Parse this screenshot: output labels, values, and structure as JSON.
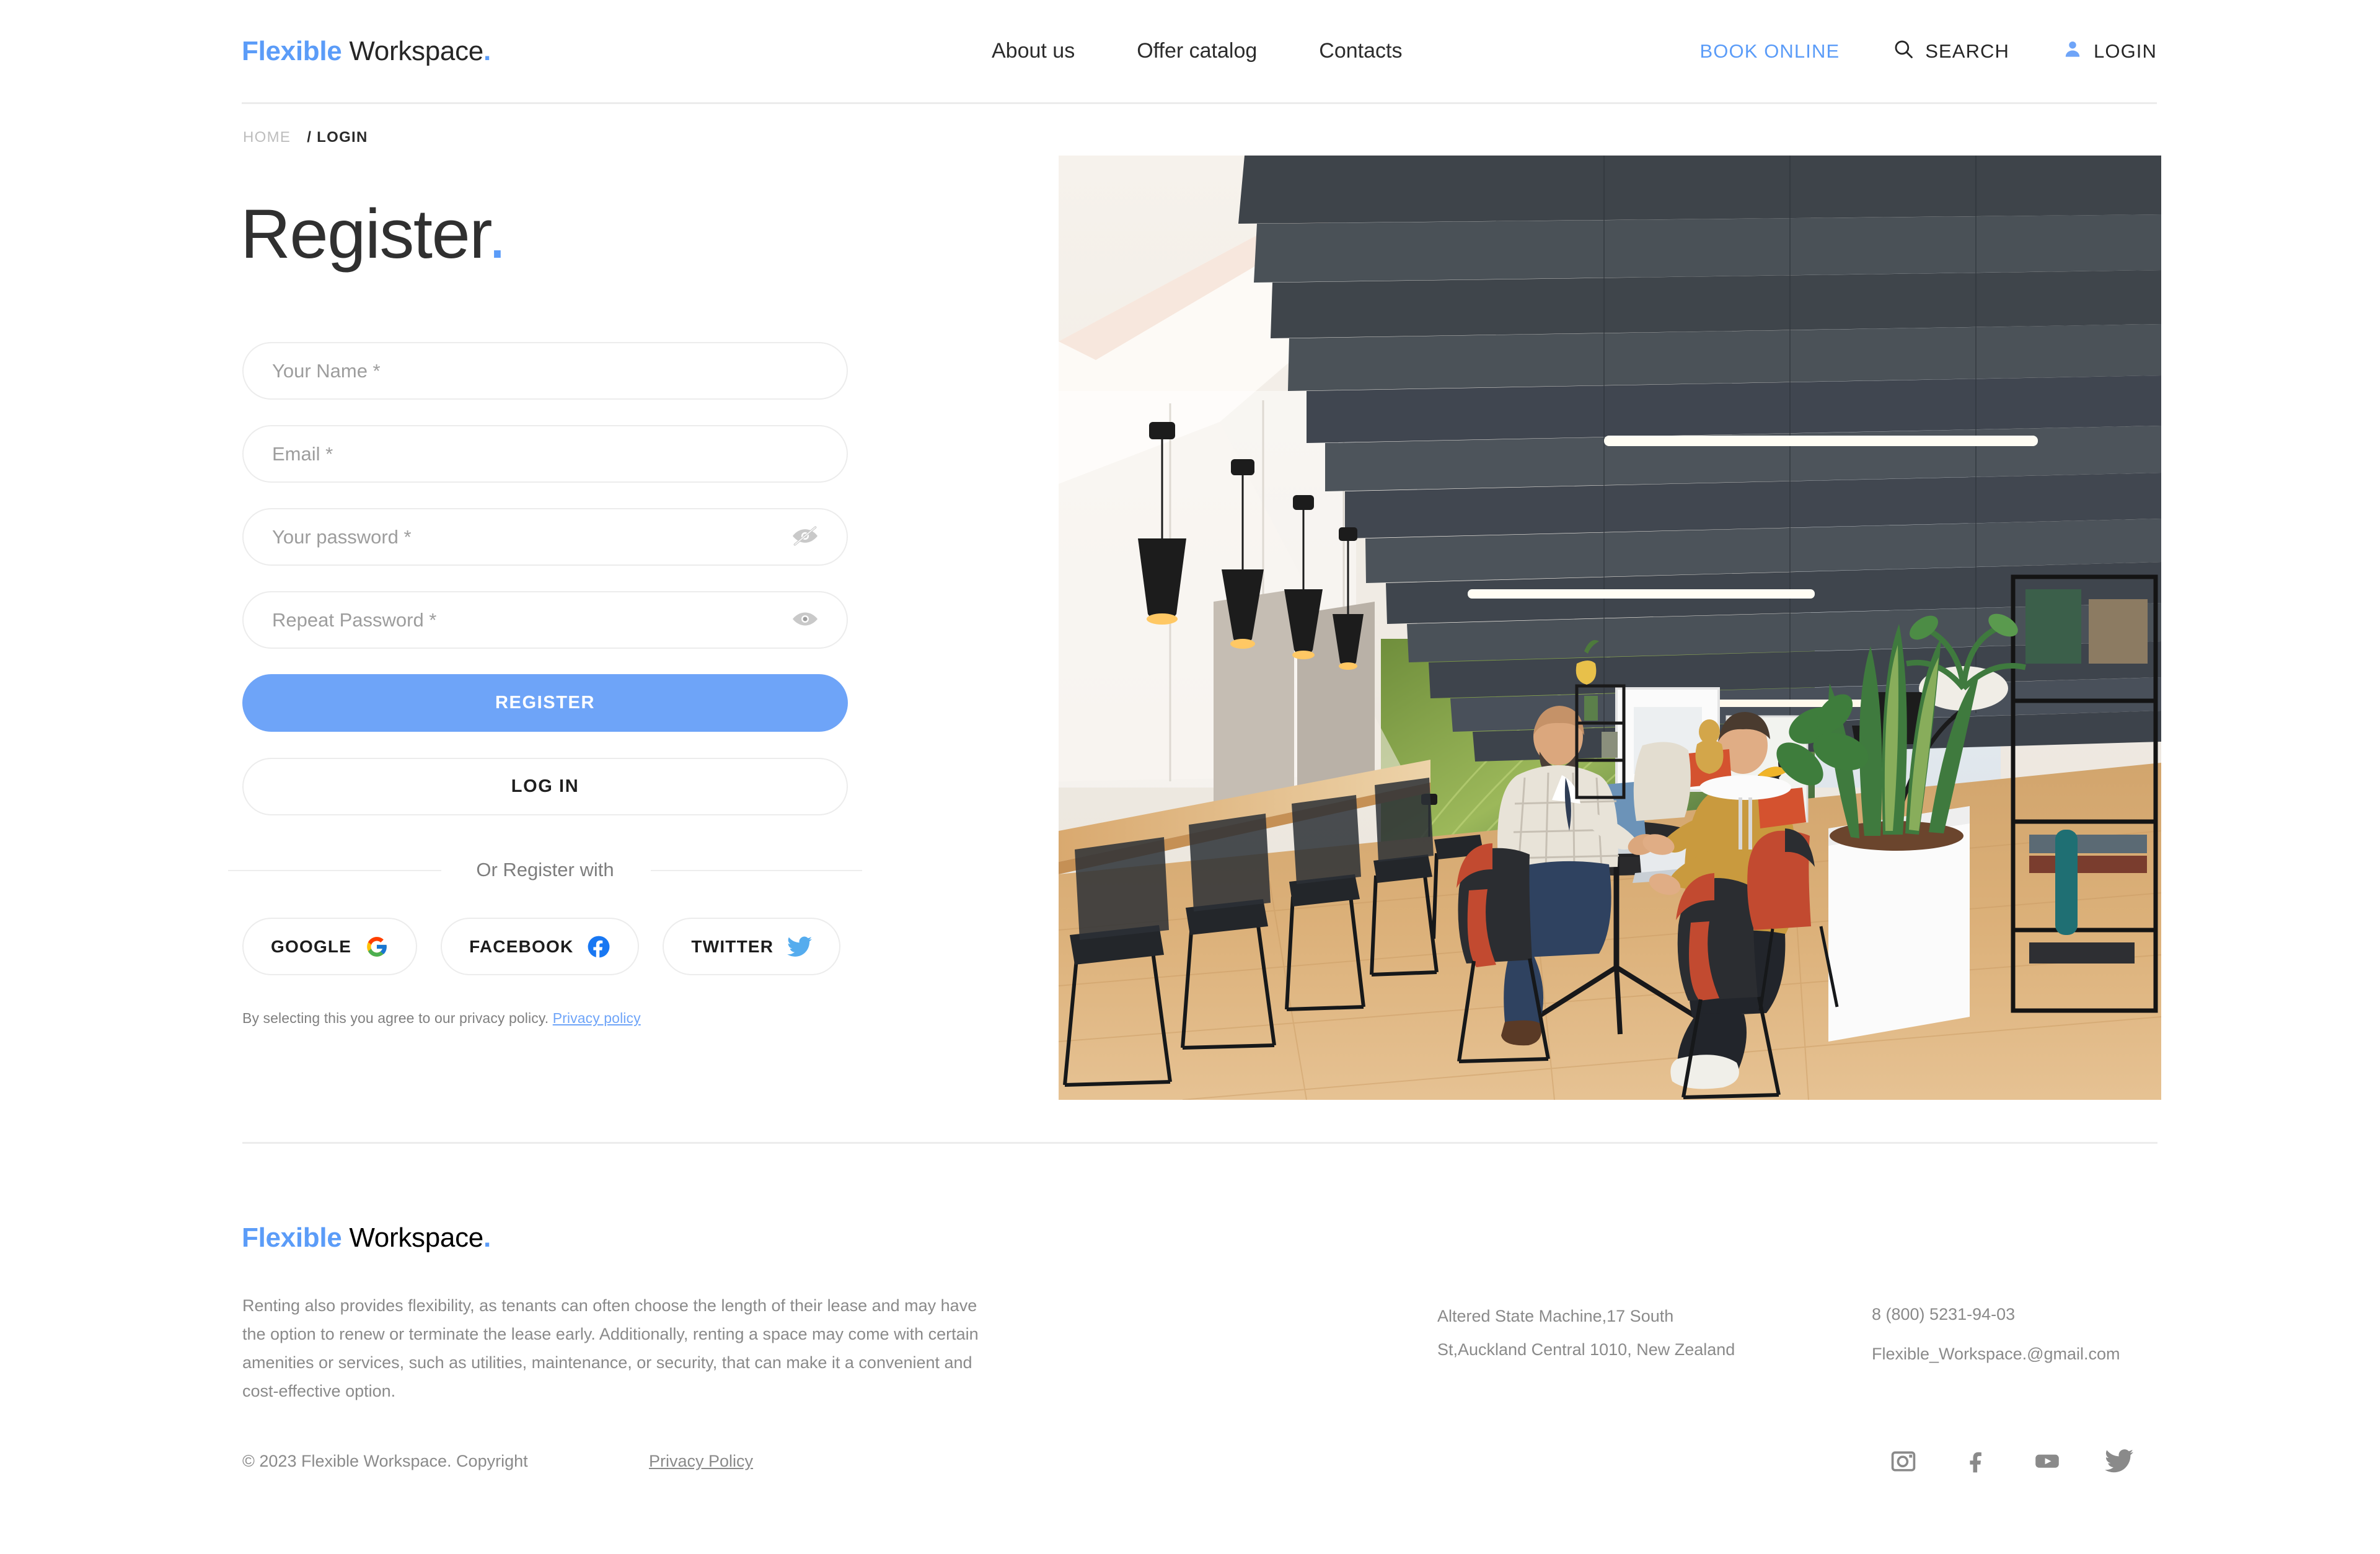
{
  "brand": {
    "accent": "Flexible",
    "plain": " Workspace",
    "dot": "."
  },
  "header": {
    "nav": [
      {
        "label": "About us"
      },
      {
        "label": "Offer catalog"
      },
      {
        "label": "Contacts"
      }
    ],
    "book_online": "BOOK ONLINE",
    "search": "SEARCH",
    "login": "LOGIN"
  },
  "breadcrumb": {
    "home": "HOME",
    "current": "/ LOGIN"
  },
  "page_title": {
    "text": "Register",
    "dot": "."
  },
  "form": {
    "fields": [
      {
        "name": "Your Name *",
        "placeholder": "Your Name *",
        "value": ""
      },
      {
        "name": "Email *",
        "placeholder": "Email *",
        "value": ""
      },
      {
        "name": "Your password *",
        "placeholder": "Your password *",
        "value": ""
      },
      {
        "name": "Repeat Password *",
        "placeholder": "Repeat Password *",
        "value": ""
      }
    ],
    "register_label": "REGISTER",
    "login_label": "LOG IN",
    "divider_label": "Or Register with",
    "socials": [
      {
        "label": "GOOGLE",
        "icon": "google-icon"
      },
      {
        "label": "FACEBOOK",
        "icon": "facebook-icon"
      },
      {
        "label": "TWITTER",
        "icon": "twitter-icon"
      }
    ],
    "consent_text": "By selecting this you agree to our privacy policy.",
    "consent_link": "Privacy policy"
  },
  "hero": {
    "alt": "Modern co-working space with two men working at a high table"
  },
  "footer": {
    "description": "Renting also provides flexibility, as tenants can often choose the length of their lease and may have the option to renew or terminate the lease early. Additionally, renting a space may come with certain amenities or services, such as utilities, maintenance, or security, that can make it a convenient and cost-effective option.",
    "address_line1": "Altered State Machine,17 South",
    "address_line2": "St,Auckland Central 1010, New Zealand",
    "phone": "8 (800) 5231-94-03",
    "email": "Flexible_Workspace.@gmail.com",
    "copyright": "© 2023 Flexible Workspace. Copyright",
    "privacy_policy": "Privacy Policy",
    "socials": [
      {
        "name": "instagram-icon"
      },
      {
        "name": "facebook-icon"
      },
      {
        "name": "youtube-icon"
      },
      {
        "name": "twitter-icon"
      }
    ]
  },
  "colors": {
    "accent": "#5b9cf8",
    "primary_button": "#6ea4f8",
    "border": "#ececec",
    "muted_text": "#8a8a8a"
  }
}
